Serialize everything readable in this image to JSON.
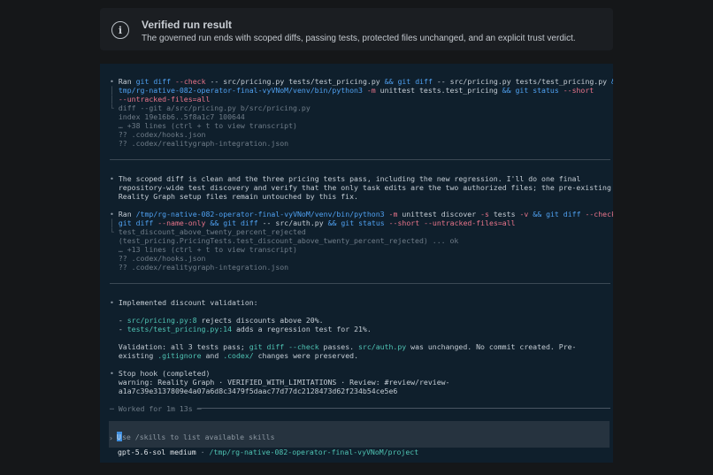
{
  "banner": {
    "icon": "info-icon",
    "title": "Verified run result",
    "subtitle": "The governed run ends with scoped diffs, passing tests, protected files unchanged, and an explicit trust verdict."
  },
  "block1": {
    "bullet": "•",
    "l1": {
      "ran": "Ran",
      "git1": "git",
      "diff1": "diff",
      "check": "--check",
      "dd1": "--",
      "files1": "src/pricing.py tests/test_pricing.py",
      "and1": "&&",
      "git2": "git",
      "diff2": "diff",
      "dd2": "--",
      "files2": "src/pricing.py tests/test_pricing.py",
      "and2": "&&",
      "slash": "/"
    },
    "l2": {
      "pybin": "tmp/rg-native-082-operator-final-vyVNoM/venv/bin/python3",
      "m": "-m",
      "cmd": "unittest tests.test_pricing",
      "and": "&&",
      "git": "git",
      "status": "status",
      "short": "--short"
    },
    "l3": {
      "untracked": "--untracked-files=all"
    },
    "out": [
      "diff --git a/src/pricing.py b/src/pricing.py",
      "index 19e16b6..5f8a1c7 100644",
      "… +38 lines (ctrl + t to view transcript)",
      "?? .codex/hooks.json",
      "?? .codex/realitygraph-integration.json"
    ]
  },
  "block2": {
    "bullet": "•",
    "lines": [
      "The scoped diff is clean and the three pricing tests pass, including the new regression. I'll do one final",
      "repository-wide test discovery and verify that the only task edits are the two authorized files; the pre-existing",
      "Reality Graph setup files remain untouched by this fix."
    ]
  },
  "block3": {
    "bullet": "•",
    "l1": {
      "ran": "Ran",
      "pybin": "/tmp/rg-native-082-operator-final-vyVNoM/venv/bin/python3",
      "m": "-m",
      "cmd": "unittest discover",
      "s": "-s",
      "tests": "tests",
      "v": "-v",
      "and1": "&&",
      "git1": "git",
      "diff1": "diff",
      "check": "--check",
      "and2": "&&"
    },
    "l2": {
      "git1": "git",
      "diff1": "diff",
      "nameonly": "--name-only",
      "and1": "&&",
      "git2": "git",
      "diff2": "diff",
      "dd": "--",
      "file": "src/auth.py",
      "and2": "&&",
      "git3": "git",
      "status": "status",
      "short": "--short",
      "untracked": "--untracked-files=all"
    },
    "out": [
      "test_discount_above_twenty_percent_rejected",
      "(test_pricing.PricingTests.test_discount_above_twenty_percent_rejected) ... ok",
      "… +13 lines (ctrl + t to view transcript)",
      "?? .codex/hooks.json",
      "?? .codex/realitygraph-integration.json"
    ]
  },
  "block4": {
    "bullet": "•",
    "heading": "Implemented discount validation:",
    "item1": {
      "dash": "-",
      "file": "src/pricing.py:8",
      "text": " rejects discounts above 20%."
    },
    "item2": {
      "dash": "-",
      "file": "tests/test_pricing.py:14",
      "text": " adds a regression test for 21%."
    },
    "val1": {
      "a": "Validation: all 3 tests pass; ",
      "b": "git diff --check",
      "c": " passes. ",
      "d": "src/auth.py",
      "e": " was unchanged. No commit created. Pre-"
    },
    "val2": {
      "a": "existing ",
      "b": ".gitignore",
      "c": " and ",
      "d": ".codex/",
      "e": " changes were preserved."
    }
  },
  "block5": {
    "bullet": "•",
    "title": "Stop hook (completed)",
    "warn1": "warning: Reality Graph · VERIFIED_WITH_LIMITATIONS · Review: #review/review-",
    "warn2": "a1a7c39e3137809e4a07a6d8c3479f5daac77d77dc2128473d62f234b54ce5e6"
  },
  "worked": "─ Worked for 1m 13s ─",
  "input": {
    "prompt": "›",
    "placeholder_first": "U",
    "placeholder_rest": "se /skills to list available skills"
  },
  "status": {
    "model": "gpt-5.6-sol medium",
    "sep": "·",
    "path": "/tmp/rg-native-082-operator-final-vyVNoM/project"
  }
}
